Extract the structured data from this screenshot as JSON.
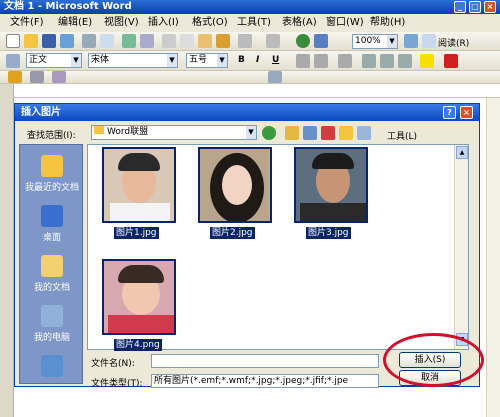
{
  "window": {
    "title": "文档 1 - Microsoft Word"
  },
  "menu": [
    "文件(F)",
    "编辑(E)",
    "视图(V)",
    "插入(I)",
    "格式(O)",
    "工具(T)",
    "表格(A)",
    "窗口(W)",
    "帮助(H)"
  ],
  "toolbar1": {
    "zoom": "100%",
    "read_label": "阅读(R)"
  },
  "toolbar2": {
    "style": "正文",
    "font": "宋体",
    "size": "五号",
    "bold": "B",
    "italic": "I",
    "underline": "U"
  },
  "dialog": {
    "title": "插入图片",
    "lookin_label": "查找范围(I):",
    "lookin_value": "Word联盟",
    "tools_label": "工具(L)",
    "places": [
      "我最近的文档",
      "桌面",
      "我的文档",
      "我的电脑",
      ""
    ],
    "files": [
      "图片1.jpg",
      "图片2.jpg",
      "图片3.jpg",
      "图片4.png"
    ],
    "filename_label": "文件名(N):",
    "filename_value": "",
    "filetype_label": "文件类型(T):",
    "filetype_value": "所有图片(*.emf;*.wmf;*.jpg;*.jpeg;*.jfif;*.jpe",
    "insert_label": "插入(S)",
    "cancel_label": "取消"
  }
}
